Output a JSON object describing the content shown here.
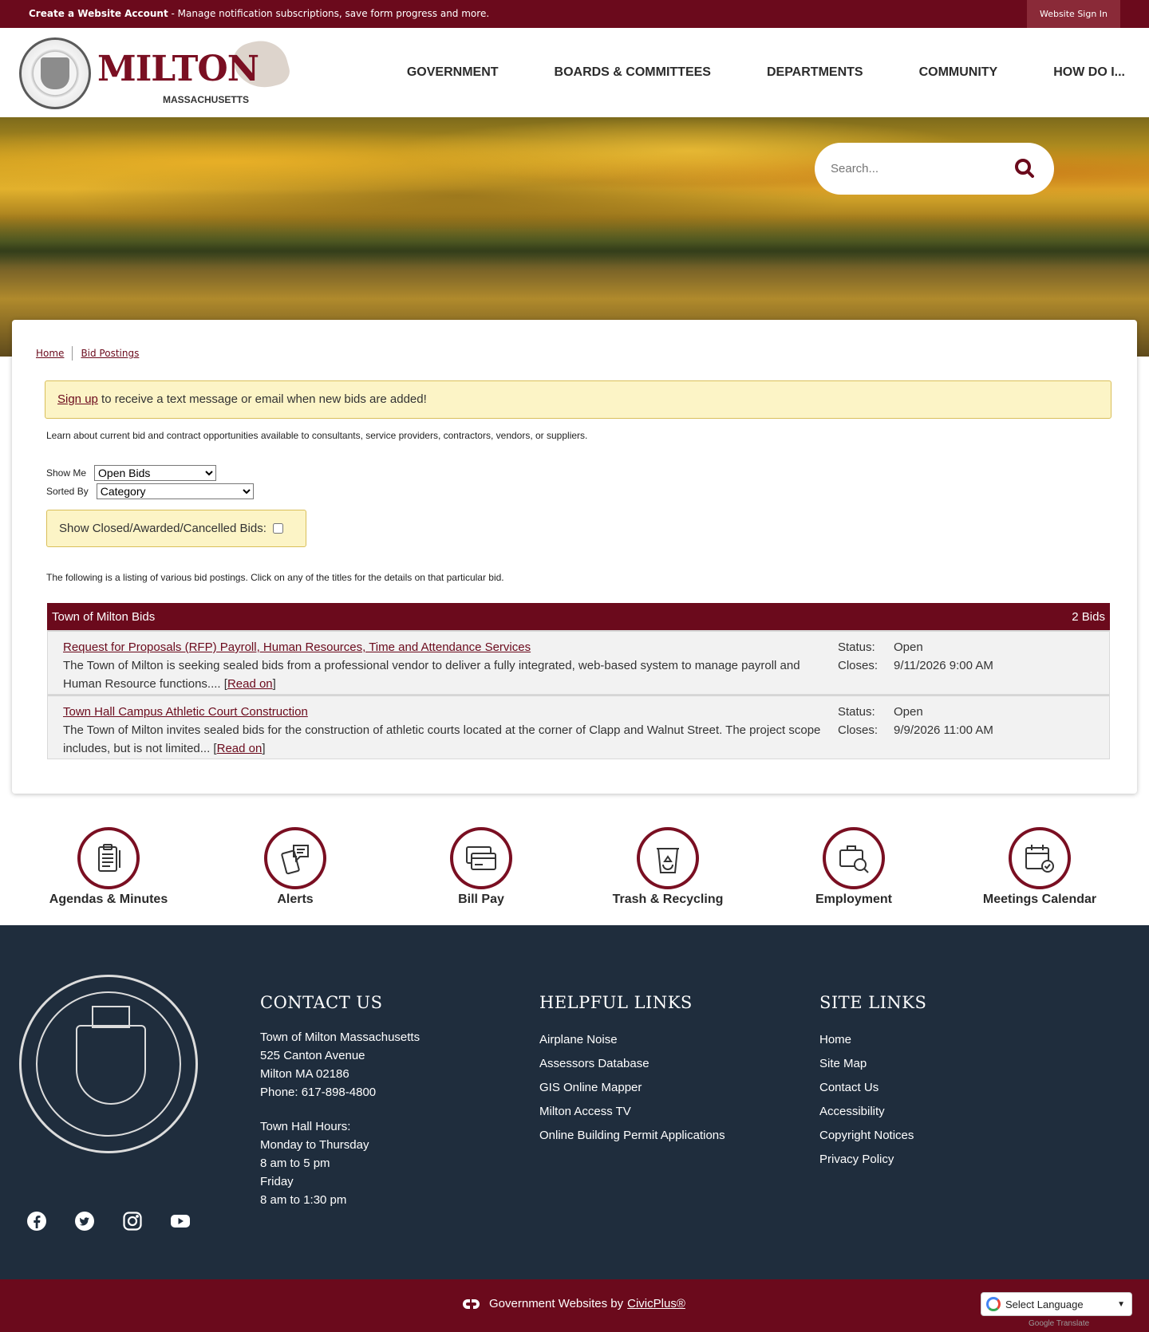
{
  "topbar": {
    "account_bold": "Create a Website Account",
    "account_rest": " - Manage notification subscriptions, save form progress and more.",
    "signin": "Website Sign In"
  },
  "logo": {
    "name": "MILTON",
    "sub": "MASSACHUSETTS"
  },
  "nav": [
    "GOVERNMENT",
    "BOARDS & COMMITTEES",
    "DEPARTMENTS",
    "COMMUNITY",
    "HOW DO I..."
  ],
  "search": {
    "placeholder": "Search..."
  },
  "breadcrumb": {
    "home": "Home",
    "current": "Bid Postings"
  },
  "signup": {
    "link": "Sign up",
    "rest": " to receive a text message or email when new bids are added!"
  },
  "intro": "Learn about current bid and contract opportunities available to consultants, service providers, contractors, vendors, or suppliers.",
  "filters": {
    "show_me_label": "Show Me",
    "show_me_value": "Open Bids",
    "sorted_by_label": "Sorted By",
    "sorted_by_value": "Category",
    "closed_label": "Show Closed/Awarded/Cancelled Bids:"
  },
  "listing_intro": "The following is a listing of various bid postings. Click on any of the titles for the details on that particular bid.",
  "bids": {
    "header": "Town of Milton Bids",
    "count": "2 Bids",
    "items": [
      {
        "title": "Request for Proposals (RFP) Payroll, Human Resources, Time and Attendance Services",
        "desc": "The Town of Milton is seeking sealed bids from a professional vendor to deliver a fully integrated, web-based system to manage payroll and Human Resource functions....",
        "read": "Read on",
        "status_label": "Status:",
        "status": "Open",
        "closes_label": "Closes:",
        "closes": "9/11/2026 9:00 AM"
      },
      {
        "title": "Town Hall Campus Athletic Court Construction",
        "desc": "The Town of Milton invites sealed bids for the construction of athletic courts located at the corner of Clapp and Walnut Street. The project scope includes, but is not limited...",
        "read": "Read on",
        "status_label": "Status:",
        "status": "Open",
        "closes_label": "Closes:",
        "closes": "9/9/2026 11:00 AM"
      }
    ]
  },
  "quick_links": [
    {
      "label": "Agendas & Minutes",
      "icon": "clipboard-icon"
    },
    {
      "label": "Alerts",
      "icon": "phone-alert-icon"
    },
    {
      "label": "Bill Pay",
      "icon": "credit-card-icon"
    },
    {
      "label": "Trash & Recycling",
      "icon": "recycling-bin-icon"
    },
    {
      "label": "Employment",
      "icon": "briefcase-search-icon"
    },
    {
      "label": "Meetings Calendar",
      "icon": "calendar-check-icon"
    }
  ],
  "footer": {
    "contact": {
      "heading": "CONTACT US",
      "lines": [
        "Town of Milton Massachusetts",
        "525 Canton Avenue",
        "Milton MA 02186",
        "Phone: 617-898-4800"
      ],
      "hours": [
        "Town Hall Hours:",
        "Monday to Thursday",
        "8 am to 5 pm",
        "Friday",
        "8 am to 1:30 pm"
      ]
    },
    "helpful": {
      "heading": "HELPFUL LINKS",
      "links": [
        "Airplane Noise",
        "Assessors Database",
        "GIS Online Mapper",
        "Milton Access TV",
        "Online Building Permit Applications"
      ]
    },
    "site": {
      "heading": "SITE LINKS",
      "links": [
        "Home",
        "Site Map",
        "Contact Us",
        "Accessibility",
        "Copyright Notices",
        "Privacy Policy"
      ]
    },
    "social": [
      "facebook-icon",
      "twitter-icon",
      "instagram-icon",
      "youtube-icon"
    ]
  },
  "bottom": {
    "credit": "Government Websites by",
    "credit_link": "CivicPlus®",
    "language": "Select Language",
    "powered": "Google Translate"
  },
  "colors": {
    "brand": "#6b0a1c",
    "footer": "#1f2d3d",
    "notice": "#fcf4c6"
  }
}
